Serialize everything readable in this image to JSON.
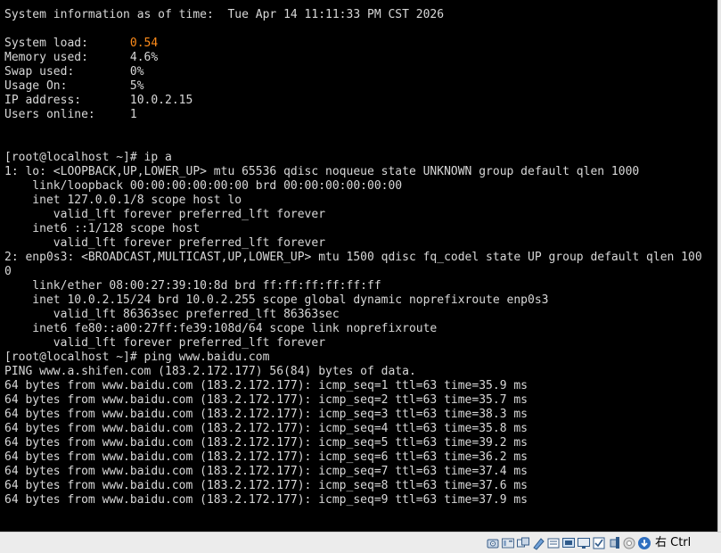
{
  "terminal": {
    "lines": [
      "System information as of time:  Tue Apr 14 11:11:33 PM CST 2026",
      "",
      "System load:      ",
      "Memory used:      4.6%",
      "Swap used:        0%",
      "Usage On:         5%",
      "IP address:       10.0.2.15",
      "Users online:     1",
      "",
      "",
      "[root@localhost ~]# ip a",
      "1: lo: <LOOPBACK,UP,LOWER_UP> mtu 65536 qdisc noqueue state UNKNOWN group default qlen 1000",
      "    link/loopback 00:00:00:00:00:00 brd 00:00:00:00:00:00",
      "    inet 127.0.0.1/8 scope host lo",
      "       valid_lft forever preferred_lft forever",
      "    inet6 ::1/128 scope host",
      "       valid_lft forever preferred_lft forever",
      "2: enp0s3: <BROADCAST,MULTICAST,UP,LOWER_UP> mtu 1500 qdisc fq_codel state UP group default qlen 100",
      "0",
      "    link/ether 08:00:27:39:10:8d brd ff:ff:ff:ff:ff:ff",
      "    inet 10.0.2.15/24 brd 10.0.2.255 scope global dynamic noprefixroute enp0s3",
      "       valid_lft 86363sec preferred_lft 86363sec",
      "    inet6 fe80::a00:27ff:fe39:108d/64 scope link noprefixroute",
      "       valid_lft forever preferred_lft forever",
      "[root@localhost ~]# ping www.baidu.com",
      "PING www.a.shifen.com (183.2.172.177) 56(84) bytes of data.",
      "64 bytes from www.baidu.com (183.2.172.177): icmp_seq=1 ttl=63 time=35.9 ms",
      "64 bytes from www.baidu.com (183.2.172.177): icmp_seq=2 ttl=63 time=35.7 ms",
      "64 bytes from www.baidu.com (183.2.172.177): icmp_seq=3 ttl=63 time=38.3 ms",
      "64 bytes from www.baidu.com (183.2.172.177): icmp_seq=4 ttl=63 time=35.8 ms",
      "64 bytes from www.baidu.com (183.2.172.177): icmp_seq=5 ttl=63 time=39.2 ms",
      "64 bytes from www.baidu.com (183.2.172.177): icmp_seq=6 ttl=63 time=36.2 ms",
      "64 bytes from www.baidu.com (183.2.172.177): icmp_seq=7 ttl=63 time=37.4 ms",
      "64 bytes from www.baidu.com (183.2.172.177): icmp_seq=8 ttl=63 time=37.6 ms",
      "64 bytes from www.baidu.com (183.2.172.177): icmp_seq=9 ttl=63 time=37.9 ms"
    ],
    "system_load_value": "0.54",
    "highlight_color": "#ff8c1a",
    "text_color": "#d8d8d8",
    "background_color": "#000000"
  },
  "statusbar": {
    "icons": [
      "hard-disk-icon",
      "optical-drive-icon",
      "audio-icon",
      "network-icon",
      "usb-icon",
      "shared-folders-icon",
      "display-icon",
      "recording-icon",
      "cpu-icon",
      "mouse-integration-icon",
      "keyboard-capture-icon"
    ],
    "host_key": "右 Ctrl"
  }
}
